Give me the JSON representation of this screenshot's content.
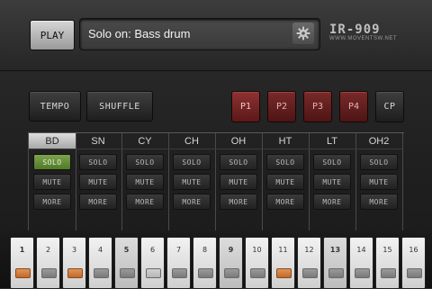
{
  "header": {
    "play_label": "PLAY",
    "display_text": "Solo on: Bass drum",
    "logo_text": "IR-909",
    "logo_sub": "WWW.MOVENTSW.NET"
  },
  "controls": {
    "tempo_label": "TEMPO",
    "shuffle_label": "SHUFFLE",
    "patterns": [
      "P1",
      "P2",
      "P3",
      "P4"
    ],
    "active_pattern": "P1",
    "cp_label": "CP"
  },
  "tracks": [
    {
      "name": "BD",
      "selected": true,
      "solo": "SOLO",
      "solo_on": true,
      "mute": "MUTE",
      "more": "MORE"
    },
    {
      "name": "SN",
      "selected": false,
      "solo": "SOLO",
      "solo_on": false,
      "mute": "MUTE",
      "more": "MORE"
    },
    {
      "name": "CY",
      "selected": false,
      "solo": "SOLO",
      "solo_on": false,
      "mute": "MUTE",
      "more": "MORE"
    },
    {
      "name": "CH",
      "selected": false,
      "solo": "SOLO",
      "solo_on": false,
      "mute": "MUTE",
      "more": "MORE"
    },
    {
      "name": "OH",
      "selected": false,
      "solo": "SOLO",
      "solo_on": false,
      "mute": "MUTE",
      "more": "MORE"
    },
    {
      "name": "HT",
      "selected": false,
      "solo": "SOLO",
      "solo_on": false,
      "mute": "MUTE",
      "more": "MORE"
    },
    {
      "name": "LT",
      "selected": false,
      "solo": "SOLO",
      "solo_on": false,
      "mute": "MUTE",
      "more": "MORE"
    },
    {
      "name": "OH2",
      "selected": false,
      "solo": "SOLO",
      "solo_on": false,
      "mute": "MUTE",
      "more": "MORE"
    }
  ],
  "steps": [
    {
      "num": "1",
      "led": "on",
      "bold": true
    },
    {
      "num": "2",
      "led": "off",
      "bold": false
    },
    {
      "num": "3",
      "led": "on",
      "bold": false
    },
    {
      "num": "4",
      "led": "off",
      "bold": false
    },
    {
      "num": "5",
      "led": "off",
      "bold": true
    },
    {
      "num": "6",
      "led": "light",
      "bold": false
    },
    {
      "num": "7",
      "led": "off",
      "bold": false
    },
    {
      "num": "8",
      "led": "off",
      "bold": false
    },
    {
      "num": "9",
      "led": "off",
      "bold": true
    },
    {
      "num": "10",
      "led": "off",
      "bold": false
    },
    {
      "num": "11",
      "led": "on",
      "bold": false
    },
    {
      "num": "12",
      "led": "off",
      "bold": false
    },
    {
      "num": "13",
      "led": "off",
      "bold": true
    },
    {
      "num": "14",
      "led": "off",
      "bold": false
    },
    {
      "num": "15",
      "led": "off",
      "bold": false
    },
    {
      "num": "16",
      "led": "off",
      "bold": false
    }
  ]
}
